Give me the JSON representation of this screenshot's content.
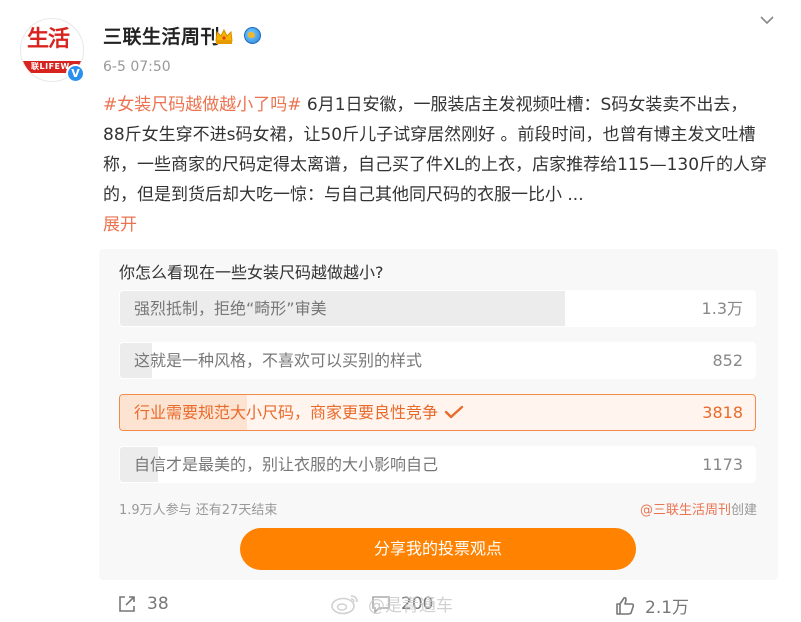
{
  "account": {
    "name": "三联生活周刊",
    "avatar_text": "生活",
    "avatar_strip": "联LIFEW",
    "time": "6-5 07:50"
  },
  "post": {
    "hashtag": "#女装尺码越做越小了吗#",
    "body": " 6月1日安徽，一服装店主发视频吐槽：S码女装卖不出去，88斤女生穿不进s码女裙，让50斤儿子试穿居然刚好 。前段时间，也曾有博主发文吐槽称，一些商家的尺码定得太离谱，自己买了件XL的上衣，店家推荐给115—130斤的人穿的，但是到货后却大吃一惊：与自己其他同尺码的衣服一比小 ...",
    "expand_label": "展开"
  },
  "poll": {
    "question": "你怎么看现在一些女装尺码越做越小?",
    "options": [
      {
        "label": "强烈抵制，拒绝“畸形”审美",
        "count": "1.3万",
        "share": 0.7,
        "selected": false
      },
      {
        "label": "这就是一种风格，不喜欢可以买别的样式",
        "count": "852",
        "share": 0.05,
        "selected": false
      },
      {
        "label": "行业需要规范大小尺码，商家更要良性竞争",
        "count": "3818",
        "share": 0.2,
        "selected": true
      },
      {
        "label": "自信才是最美的，别让衣服的大小影响自己",
        "count": "1173",
        "share": 0.06,
        "selected": false
      }
    ],
    "stats": "1.9万人参与 还有27天结束",
    "creator_link": "@三联生活周刊",
    "creator_suffix": "创建",
    "share_label": "分享我的投票观点"
  },
  "actions": {
    "repost_count": "38",
    "comment_count": "200",
    "like_count": "2.1万"
  },
  "watermark": "@是青通车",
  "colors": {
    "accent": "#eb7350",
    "button": "#ff8200"
  }
}
